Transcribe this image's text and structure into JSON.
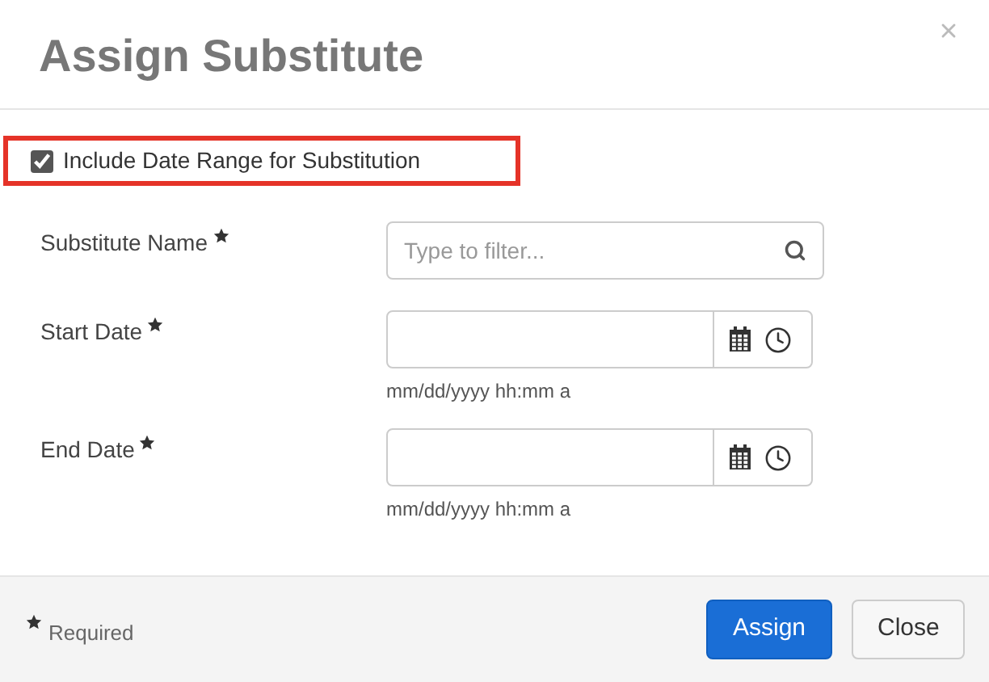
{
  "dialog": {
    "title": "Assign Substitute"
  },
  "include_range": {
    "label": "Include Date Range for Substitution",
    "checked": true,
    "highlighted": true
  },
  "fields": [
    {
      "kind": "search",
      "label": "Substitute Name",
      "required": true,
      "placeholder": "Type to filter..."
    },
    {
      "kind": "datetime",
      "label": "Start Date",
      "required": true,
      "hint": "mm/dd/yyyy hh:mm a"
    },
    {
      "kind": "datetime",
      "label": "End Date",
      "required": true,
      "hint": "mm/dd/yyyy hh:mm a"
    }
  ],
  "footer": {
    "required_note": "Required",
    "buttons": [
      {
        "label": "Assign",
        "kind": "primary"
      },
      {
        "label": "Close",
        "kind": "default"
      }
    ]
  }
}
